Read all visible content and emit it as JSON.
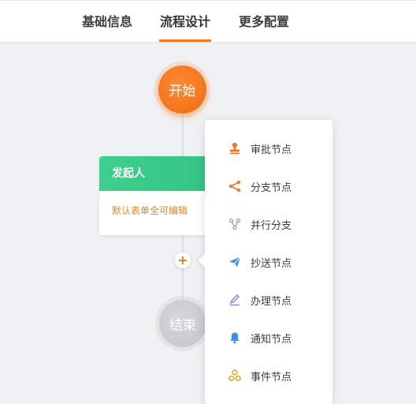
{
  "tabs": [
    {
      "label": "基础信息",
      "active": false
    },
    {
      "label": "流程设计",
      "active": true
    },
    {
      "label": "更多配置",
      "active": false
    }
  ],
  "flow": {
    "start_label": "开始",
    "end_label": "结束",
    "add_symbol": "+",
    "node": {
      "title": "发起人",
      "description": "默认表单全可编辑"
    }
  },
  "menu": {
    "items": [
      {
        "label": "审批节点",
        "icon": "stamp-icon",
        "color": "#f07a23"
      },
      {
        "label": "分支节点",
        "icon": "branch-icon",
        "color": "#f07a23"
      },
      {
        "label": "并行分支",
        "icon": "parallel-icon",
        "color": "#9aa0a8"
      },
      {
        "label": "抄送节点",
        "icon": "send-icon",
        "color": "#3d8fe0"
      },
      {
        "label": "办理节点",
        "icon": "pen-icon",
        "color": "#8f7ae6"
      },
      {
        "label": "通知节点",
        "icon": "bell-icon",
        "color": "#3d8fe0"
      },
      {
        "label": "事件节点",
        "icon": "event-icon",
        "color": "#f0a020"
      }
    ]
  },
  "colors": {
    "accent": "#f07a23",
    "node_header": "#3ecf8e",
    "node_text": "#e38530"
  }
}
